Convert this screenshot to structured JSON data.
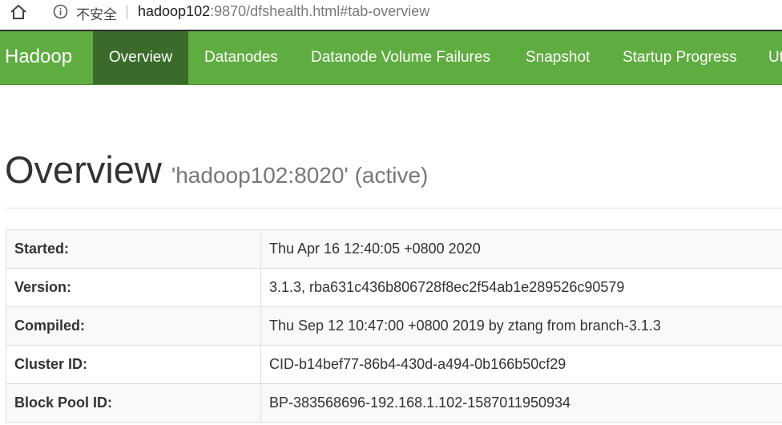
{
  "browser": {
    "insecure_label": "不安全",
    "url_host": "hadoop102",
    "url_rest": ":9870/dfshealth.html#tab-overview"
  },
  "navbar": {
    "brand": "Hadoop",
    "items": [
      {
        "label": "Overview",
        "active": true
      },
      {
        "label": "Datanodes"
      },
      {
        "label": "Datanode Volume Failures"
      },
      {
        "label": "Snapshot"
      },
      {
        "label": "Startup Progress"
      },
      {
        "label": "Ut"
      }
    ],
    "color": "#5fad41",
    "active_color": "#3a6b2a"
  },
  "page": {
    "title": "Overview",
    "subtitle": "'hadoop102:8020' (active)"
  },
  "overview_table": [
    {
      "key": "Started:",
      "value": "Thu Apr 16 12:40:05 +0800 2020"
    },
    {
      "key": "Version:",
      "value": "3.1.3, rba631c436b806728f8ec2f54ab1e289526c90579"
    },
    {
      "key": "Compiled:",
      "value": "Thu Sep 12 10:47:00 +0800 2019 by ztang from branch-3.1.3"
    },
    {
      "key": "Cluster ID:",
      "value": "CID-b14bef77-86b4-430d-a494-0b166b50cf29"
    },
    {
      "key": "Block Pool ID:",
      "value": "BP-383568696-192.168.1.102-1587011950934"
    }
  ]
}
